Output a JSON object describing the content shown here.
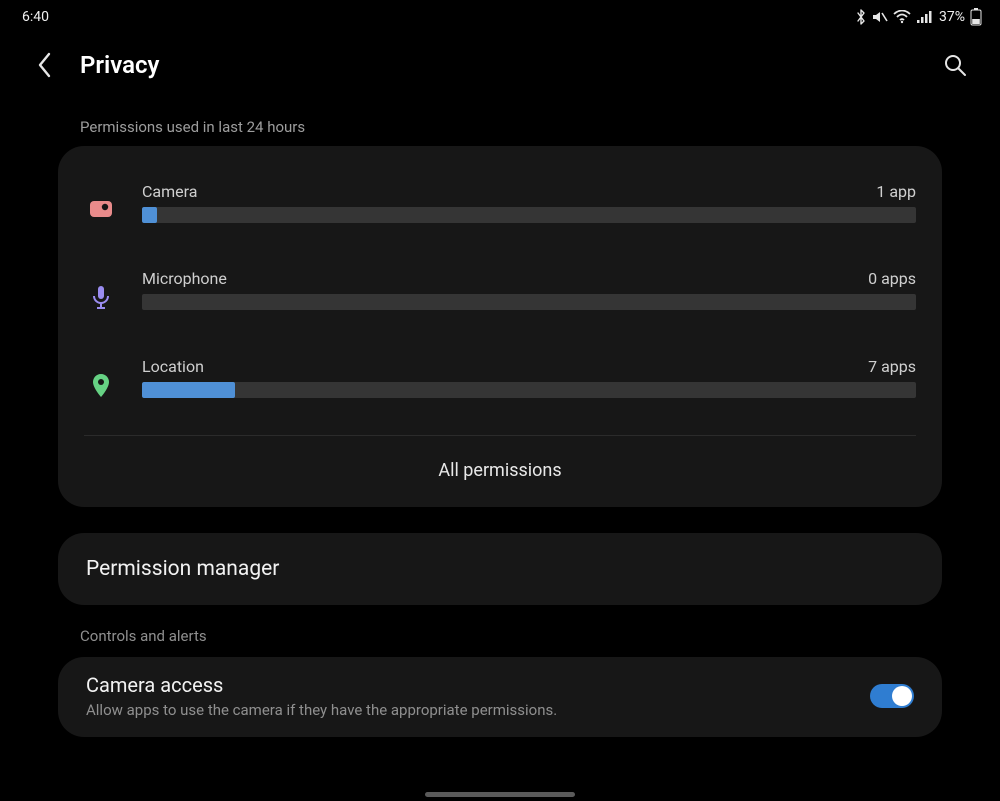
{
  "status": {
    "time": "6:40",
    "battery_text": "37%"
  },
  "header": {
    "title": "Privacy"
  },
  "sections": {
    "usage_label": "Permissions used in last 24 hours",
    "controls_label": "Controls and alerts"
  },
  "permissions": {
    "items": [
      {
        "label": "Camera",
        "count_label": "1 app",
        "fill_pct": 2,
        "color": "#4f90d6",
        "icon": "camera",
        "icon_color": "#e98b8b"
      },
      {
        "label": "Microphone",
        "count_label": "0 apps",
        "fill_pct": 0,
        "color": "#4f90d6",
        "icon": "microphone",
        "icon_color": "#9a8cf0"
      },
      {
        "label": "Location",
        "count_label": "7 apps",
        "fill_pct": 12,
        "color": "#4f90d6",
        "icon": "location",
        "icon_color": "#66d284"
      }
    ],
    "footer_label": "All permissions"
  },
  "permission_manager": {
    "title": "Permission manager"
  },
  "camera_access": {
    "title": "Camera access",
    "subtitle": "Allow apps to use the camera if they have the appropriate permissions.",
    "enabled": true
  },
  "chart_data": {
    "type": "bar",
    "title": "Permissions used in last 24 hours",
    "categories": [
      "Camera",
      "Microphone",
      "Location"
    ],
    "values": [
      1,
      0,
      7
    ],
    "xlabel": "",
    "ylabel": "apps"
  }
}
